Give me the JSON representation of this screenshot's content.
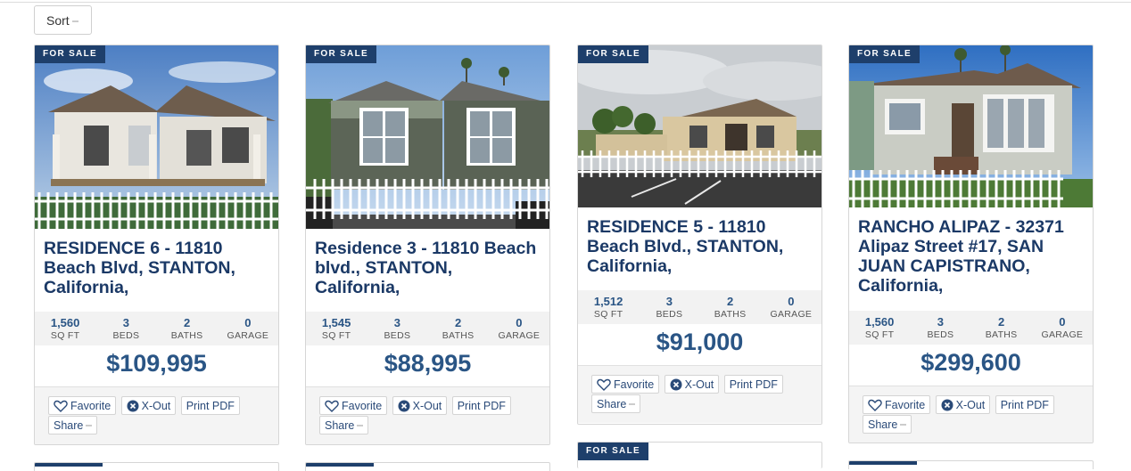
{
  "toolbar": {
    "sort_label": "Sort"
  },
  "labels": {
    "sqft": "SQ FT",
    "beds": "BEDS",
    "baths": "BATHS",
    "garage": "GARAGE"
  },
  "actions": {
    "favorite": "Favorite",
    "xout": "X-Out",
    "print": "Print PDF",
    "share": "Share"
  },
  "listings": [
    {
      "badge": "FOR SALE",
      "title": "RESIDENCE 6 - 11810 Beach Blvd, STANTON, California,",
      "sqft": "1,560",
      "beds": "3",
      "baths": "2",
      "garage": "0",
      "price": "$109,995"
    },
    {
      "badge": "FOR SALE",
      "title": "Residence 3 - 11810 Beach blvd., STANTON, California,",
      "sqft": "1,545",
      "beds": "3",
      "baths": "2",
      "garage": "0",
      "price": "$88,995"
    },
    {
      "badge": "FOR SALE",
      "title": "RESIDENCE 5 - 11810 Beach Blvd., STANTON, California,",
      "sqft": "1,512",
      "beds": "3",
      "baths": "2",
      "garage": "0",
      "price": "$91,000"
    },
    {
      "badge": "FOR SALE",
      "title": "RANCHO ALIPAZ - 32371 Alipaz Street #17, SAN JUAN CAPISTRANO, California,",
      "sqft": "1,560",
      "beds": "3",
      "baths": "2",
      "garage": "0",
      "price": "$299,600"
    }
  ],
  "next_row": {
    "badge": "FOR SALE"
  }
}
